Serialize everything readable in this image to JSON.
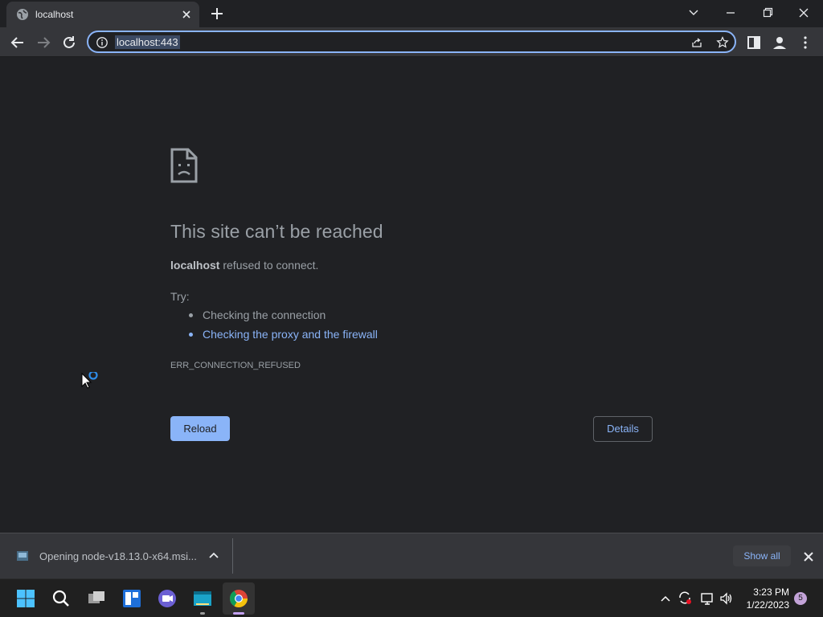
{
  "browser": {
    "tab_title": "localhost",
    "url": "localhost:443",
    "accent": "#8ab4f8"
  },
  "error_page": {
    "title": "This site can’t be reached",
    "host": "localhost",
    "message": " refused to connect.",
    "try_label": "Try:",
    "suggestions": [
      {
        "text": "Checking the connection",
        "is_link": false
      },
      {
        "text": "Checking the proxy and the firewall",
        "is_link": true
      }
    ],
    "error_code": "ERR_CONNECTION_REFUSED",
    "reload_label": "Reload",
    "details_label": "Details",
    "icon": "sad-page-icon"
  },
  "download_shelf": {
    "item_text": "Opening node-v18.13.0-x64.msi...",
    "show_all_label": "Show all"
  },
  "taskbar": {
    "apps": [
      "start",
      "search",
      "task-view",
      "widgets",
      "teams-chat",
      "file-explorer",
      "chrome"
    ],
    "time": "3:23 PM",
    "date": "1/22/2023",
    "notification_count": "5"
  }
}
